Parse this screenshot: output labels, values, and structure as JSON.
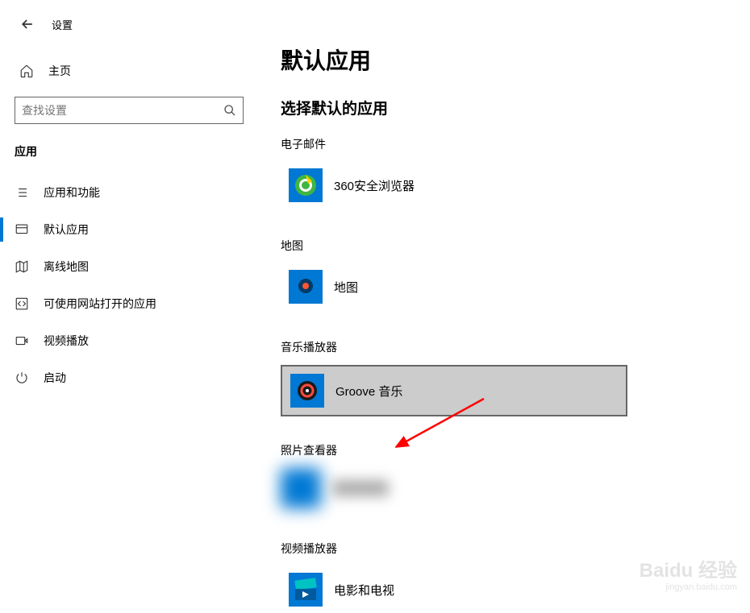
{
  "header": {
    "settings_label": "设置",
    "home_label": "主页"
  },
  "search": {
    "placeholder": "查找设置"
  },
  "sidebar": {
    "section": "应用",
    "items": [
      {
        "label": "应用和功能",
        "icon": "list-icon"
      },
      {
        "label": "默认应用",
        "icon": "defaults-icon"
      },
      {
        "label": "离线地图",
        "icon": "map-icon"
      },
      {
        "label": "可使用网站打开的应用",
        "icon": "web-app-icon"
      },
      {
        "label": "视频播放",
        "icon": "video-icon"
      },
      {
        "label": "启动",
        "icon": "startup-icon"
      }
    ]
  },
  "main": {
    "title": "默认应用",
    "subtitle": "选择默认的应用",
    "categories": [
      {
        "label": "电子邮件",
        "app": "360安全浏览器",
        "icon": "browser360-icon"
      },
      {
        "label": "地图",
        "app": "地图",
        "icon": "maps-pin-icon"
      },
      {
        "label": "音乐播放器",
        "app": "Groove 音乐",
        "icon": "groove-icon",
        "selected": true
      },
      {
        "label": "照片查看器",
        "app": "blurred",
        "icon": "blurred-icon"
      },
      {
        "label": "视频播放器",
        "app": "电影和电视",
        "icon": "movies-icon"
      }
    ]
  },
  "colors": {
    "accent": "#0078d4"
  },
  "watermark": {
    "brand": "Baidu 经验",
    "url": "jingyan.baidu.com"
  }
}
